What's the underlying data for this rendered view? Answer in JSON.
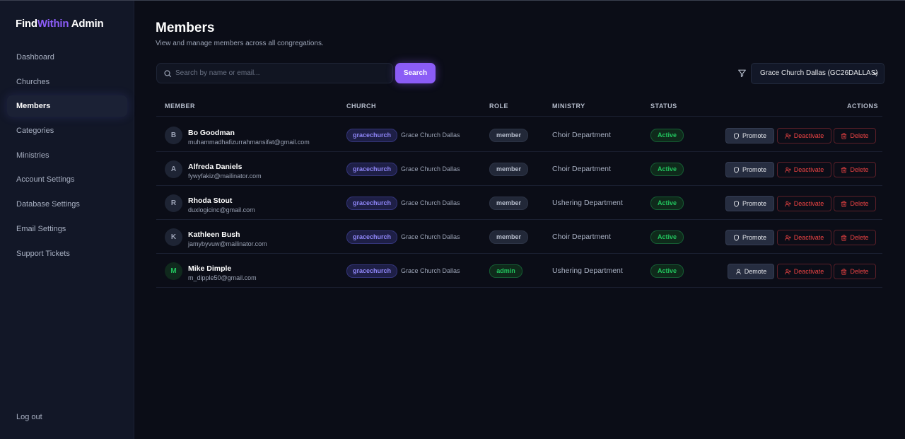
{
  "sidebar": {
    "brand": {
      "part1": "Find",
      "part2": "Within",
      "part3": " Admin"
    },
    "items": [
      {
        "label": "Dashboard",
        "active": false
      },
      {
        "label": "Churches",
        "active": false
      },
      {
        "label": "Members",
        "active": true
      },
      {
        "label": "Categories",
        "active": false
      },
      {
        "label": "Ministries",
        "active": false
      },
      {
        "label": "Account Settings",
        "active": false
      },
      {
        "label": "Database Settings",
        "active": false
      },
      {
        "label": "Email Settings",
        "active": false
      },
      {
        "label": "Support Tickets",
        "active": false
      }
    ],
    "logout_label": "Log out"
  },
  "header": {
    "title": "Members",
    "subtitle": "View and manage members across all congregations."
  },
  "search": {
    "placeholder": "Search by name or email...",
    "value": "",
    "button_label": "Search"
  },
  "filter": {
    "selected": "Grace Church Dallas (GC26DALLAS)"
  },
  "table": {
    "columns": [
      "MEMBER",
      "CHURCH",
      "ROLE",
      "MINISTRY",
      "STATUS",
      "ACTIONS"
    ],
    "rows": [
      {
        "initial": "B",
        "name": "Bo Goodman",
        "email": "muhammadhafizurrahmansifat@gmail.com",
        "church_tag": "gracechurch",
        "church_name": "Grace Church Dallas",
        "role": "member",
        "ministry": "Choir Department",
        "status": "Active",
        "primary_action": "Promote",
        "deactivate": "Deactivate",
        "delete": "Delete"
      },
      {
        "initial": "A",
        "name": "Alfreda Daniels",
        "email": "fywyfakiz@mailinator.com",
        "church_tag": "gracechurch",
        "church_name": "Grace Church Dallas",
        "role": "member",
        "ministry": "Choir Department",
        "status": "Active",
        "primary_action": "Promote",
        "deactivate": "Deactivate",
        "delete": "Delete"
      },
      {
        "initial": "R",
        "name": "Rhoda Stout",
        "email": "duxlogicinc@gmail.com",
        "church_tag": "gracechurch",
        "church_name": "Grace Church Dallas",
        "role": "member",
        "ministry": "Ushering Department",
        "status": "Active",
        "primary_action": "Promote",
        "deactivate": "Deactivate",
        "delete": "Delete"
      },
      {
        "initial": "K",
        "name": "Kathleen Bush",
        "email": "jamybyvuw@mailinator.com",
        "church_tag": "gracechurch",
        "church_name": "Grace Church Dallas",
        "role": "member",
        "ministry": "Choir Department",
        "status": "Active",
        "primary_action": "Promote",
        "deactivate": "Deactivate",
        "delete": "Delete"
      },
      {
        "initial": "M",
        "name": "Mike Dimple",
        "email": "m_dipple50@gmail.com",
        "church_tag": "gracechurch",
        "church_name": "Grace Church Dallas",
        "role": "admin",
        "ministry": "Ushering Department",
        "status": "Active",
        "primary_action": "Demote",
        "deactivate": "Deactivate",
        "delete": "Delete"
      }
    ]
  },
  "colors": {
    "accent": "#8b5cf6",
    "background": "#0b0d17",
    "sidebar": "#121727",
    "success": "#22c55e",
    "danger": "#ef4444"
  }
}
